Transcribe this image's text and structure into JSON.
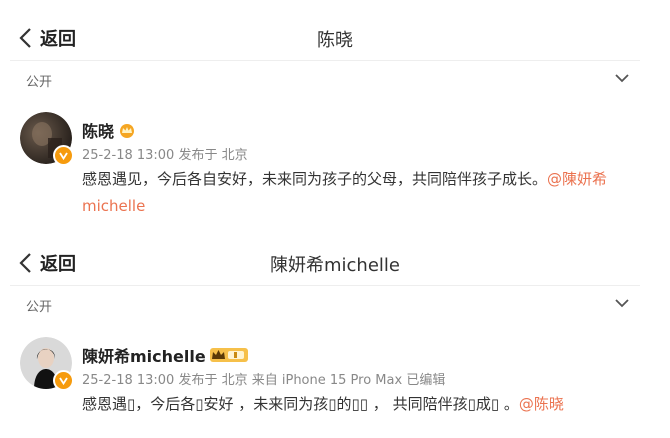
{
  "panels": [
    {
      "back_label": "返回",
      "title": "陈晓",
      "visibility": "公开",
      "author": {
        "name": "陈晓"
      },
      "meta": "25-2-18 13:00 发布于 北京",
      "content_text": "感恩遇见，今后各自安好，未来同为孩子的父母，共同陪伴孩子成长。",
      "mention": "@陳妍希michelle"
    },
    {
      "back_label": "返回",
      "title": "陳妍希michelle",
      "visibility": "公开",
      "author": {
        "name": "陳妍希michelle"
      },
      "meta": "25-2-18 13:00 发布于 北京 来自 iPhone 15 Pro Max 已编辑",
      "content_text": "感恩遇▯，今后各▯安好 ，未来同为孩▯的▯▯ ， 共同陪伴孩▯成▯ 。",
      "mention": "@陈晓"
    }
  ],
  "colors": {
    "accent": "#eb7350",
    "verified": "#f69b0e"
  },
  "icons": {
    "back": "chevron-left-icon",
    "expand": "chevron-down-icon",
    "verified": "verified-icon",
    "crown": "crown-icon"
  }
}
